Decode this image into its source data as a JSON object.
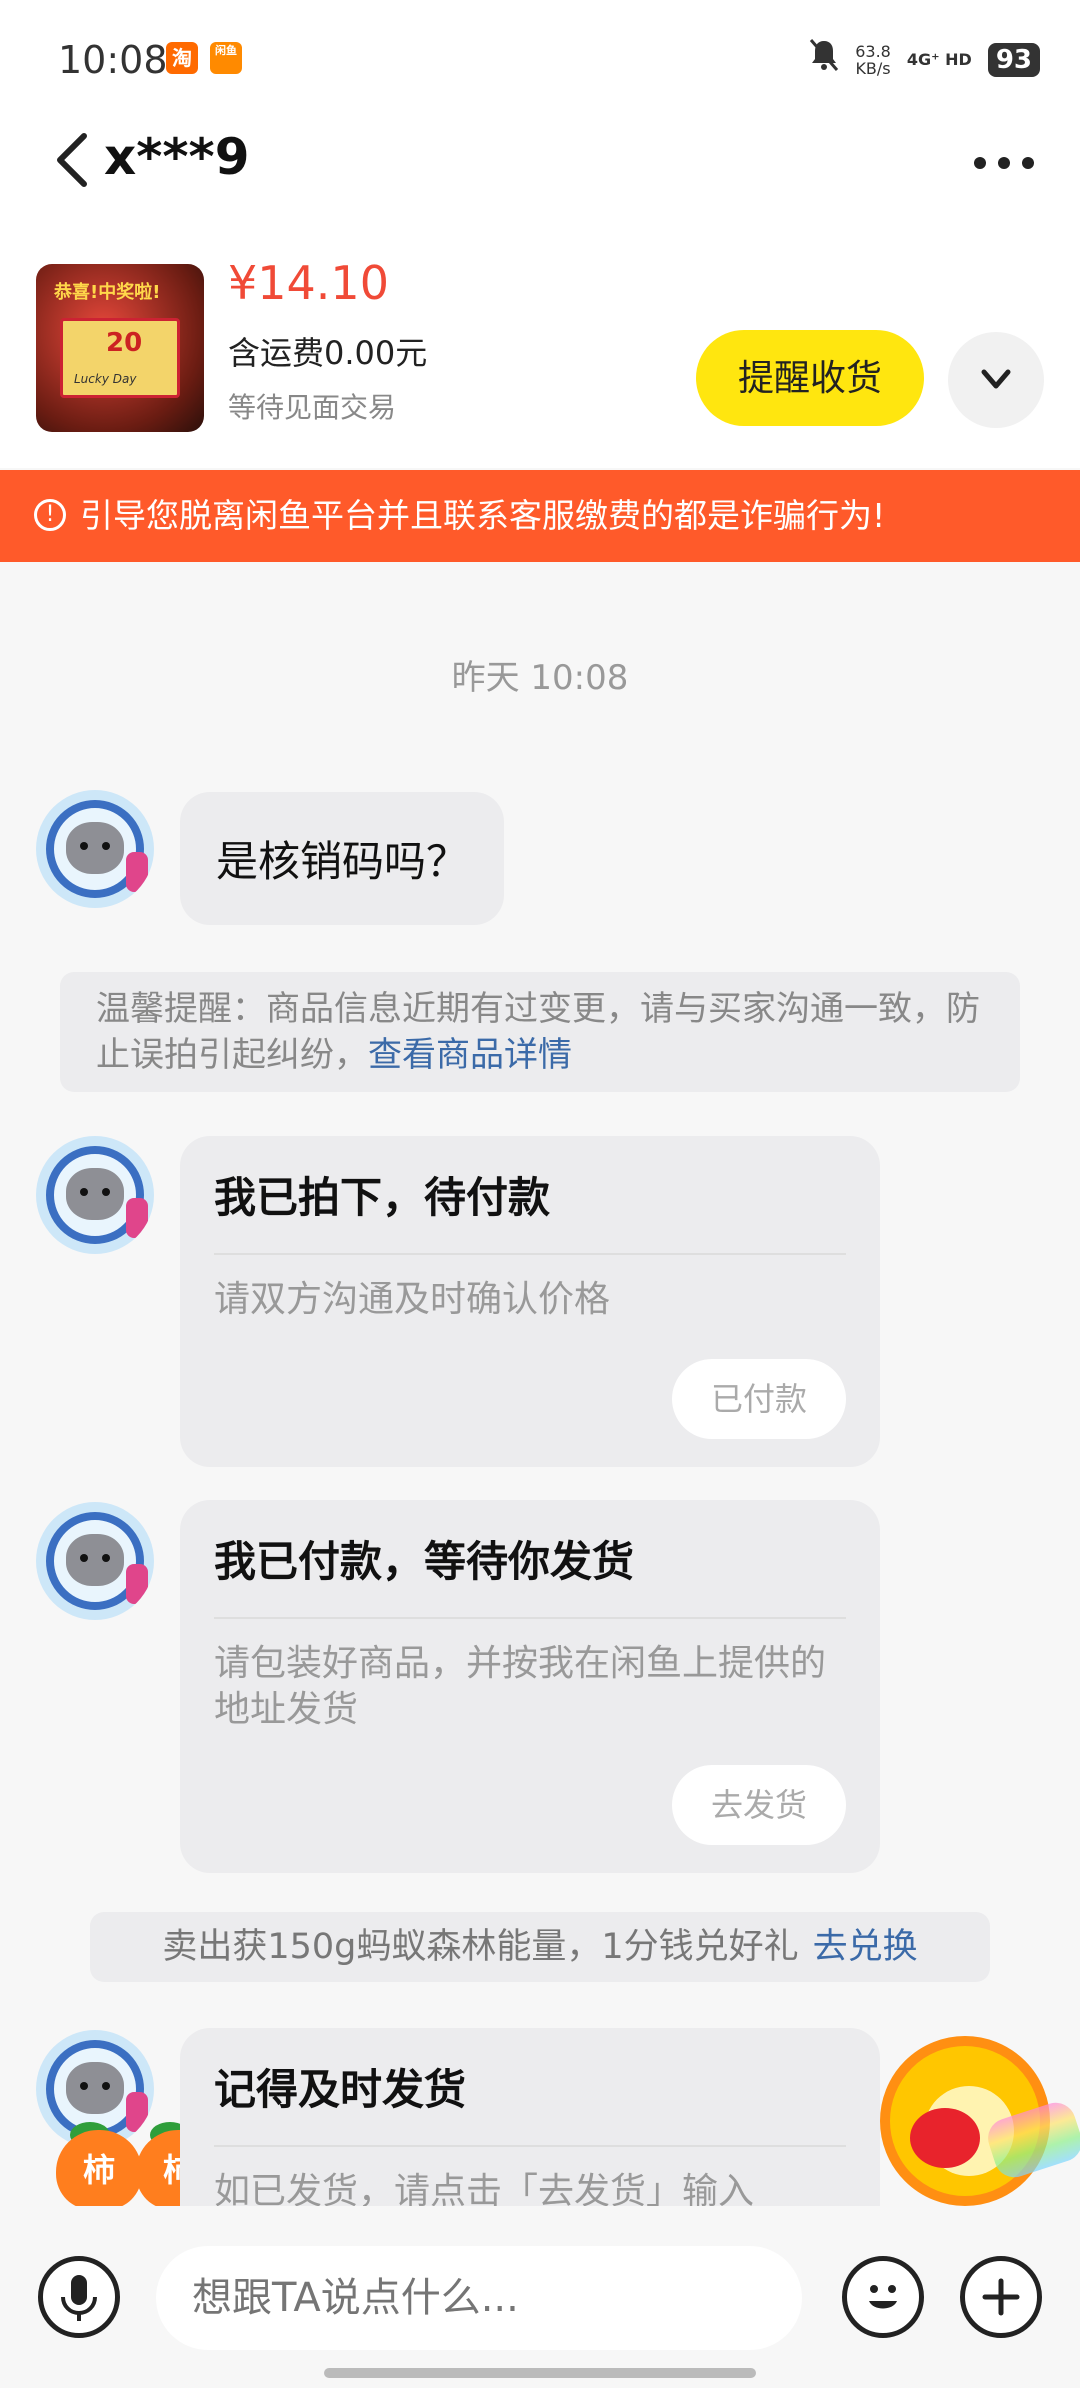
{
  "status_bar": {
    "time": "10:08",
    "app1_label": "淘",
    "app2_label": "闲鱼",
    "speed_value": "63.8",
    "speed_unit": "KB/s",
    "network": "4G⁺ HD",
    "battery": "93"
  },
  "header": {
    "title": "x***9"
  },
  "product": {
    "thumb_banner": "恭喜!中奖啦!",
    "thumb_value": "20",
    "thumb_sub": "Lucky Day",
    "price": "¥14.10",
    "shipping": "含运费0.00元",
    "status": "等待见面交易",
    "remind_label": "提醒收货"
  },
  "warning": {
    "icon": "!",
    "text": "引导您脱离闲鱼平台并且联系客服缴费的都是诈骗行为!"
  },
  "chat": {
    "timestamp": "昨天 10:08",
    "message1": "是核销码吗？",
    "notice_text": "温馨提醒：商品信息近期有过变更，请与买家沟通一致，防止误拍引起纠纷，",
    "notice_link": "查看商品详情",
    "card1": {
      "title": "我已拍下，待付款",
      "body": "请双方沟通及时确认价格",
      "button": "已付款"
    },
    "card2": {
      "title": "我已付款，等待你发货",
      "body": "请包装好商品，并按我在闲鱼上提供的地址发货",
      "button": "去发货"
    },
    "exchange_text": "卖出获150g蚂蚁森林能量，1分钱兑好礼",
    "exchange_link": "去兑换",
    "card3": {
      "title": "记得及时发货",
      "body": "如已发货，请点击「去发货」输入"
    },
    "sticker_labels": [
      "柿",
      "柿"
    ]
  },
  "input_bar": {
    "placeholder": "想跟TA说点什么..."
  },
  "colors": {
    "accent_yellow": "#ffe60f",
    "warning_orange": "#ff5a2a",
    "price_red": "#f04a37",
    "link_blue": "#3b6aa8"
  },
  "icons": [
    "back-arrow-icon",
    "more-icon",
    "chevron-down-icon",
    "warning-icon",
    "microphone-icon",
    "emoji-icon",
    "plus-icon",
    "mute-bell-icon"
  ]
}
